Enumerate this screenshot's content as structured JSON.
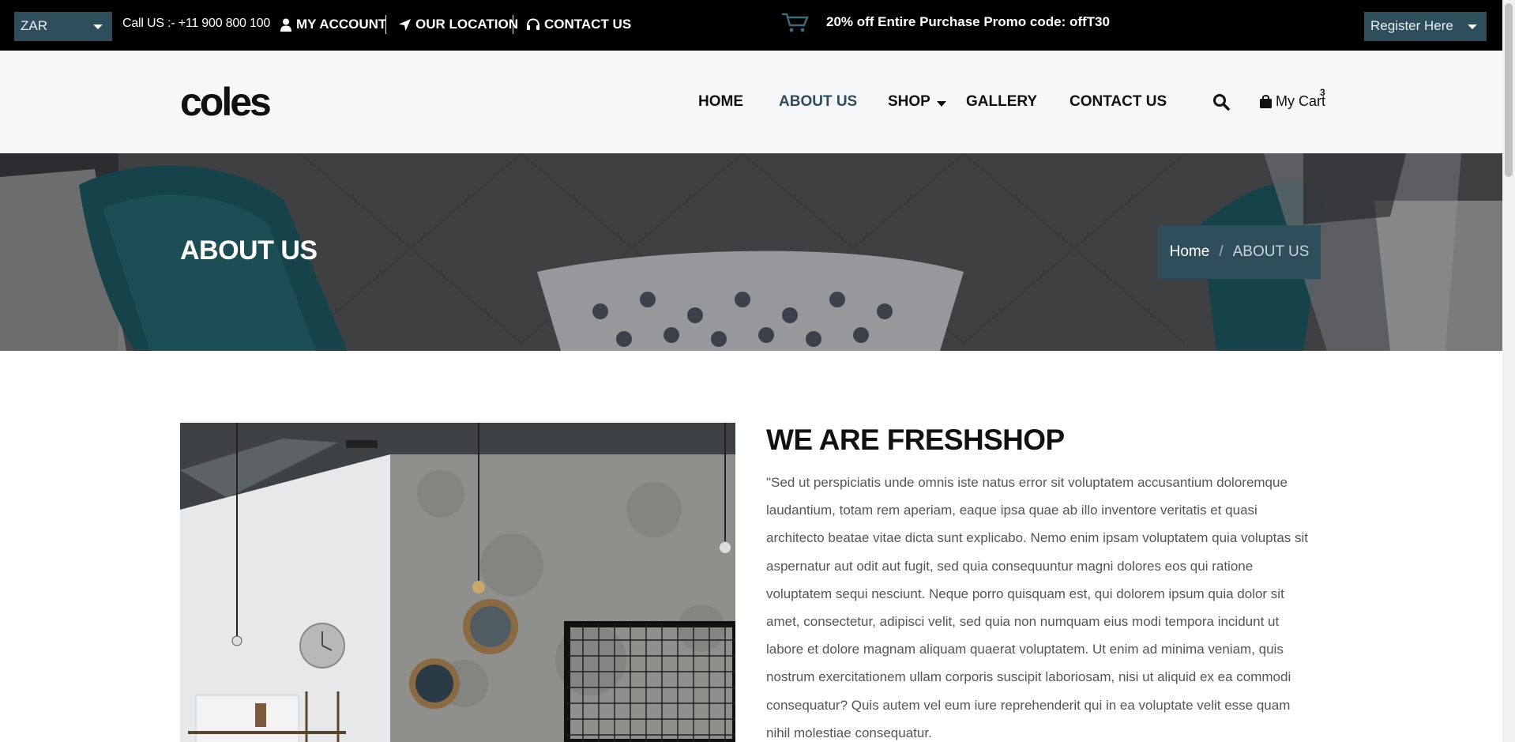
{
  "topbar": {
    "currency": "ZAR",
    "call": "Call US :- +11 900 800 100",
    "my_account": "MY ACCOUNT",
    "our_location": "OUR LOCATION",
    "contact_us": "CONTACT US",
    "promo": "20% off Entire Purchase Promo code: offT30",
    "register": "Register Here"
  },
  "header": {
    "logo": "coles",
    "nav": [
      "HOME",
      "ABOUT US",
      "SHOP",
      "GALLERY",
      "CONTACT US"
    ],
    "active_nav": "ABOUT US",
    "cart_label": "My Cart",
    "cart_count": "3"
  },
  "banner": {
    "title": "ABOUT US",
    "breadcrumb_home": "Home",
    "breadcrumb_sep": "/",
    "breadcrumb_current": "ABOUT US"
  },
  "about": {
    "heading": "WE ARE FRESHSHOP",
    "paragraph": "\"Sed ut perspiciatis unde omnis iste natus error sit voluptatem accusantium doloremque laudantium, totam rem aperiam, eaque ipsa quae ab illo inventore veritatis et quasi architecto beatae vitae dicta sunt explicabo. Nemo enim ipsam voluptatem quia voluptas sit aspernatur aut odit aut fugit, sed quia consequuntur magni dolores eos qui ratione voluptatem sequi nesciunt. Neque porro quisquam est, qui dolorem ipsum quia dolor sit amet, consectetur, adipisci velit, sed quia non numquam eius modi tempora incidunt ut labore et dolore magnam aliquam quaerat voluptatem. Ut enim ad minima veniam, quis nostrum exercitationem ullam corporis suscipit laboriosam, nisi ut aliquid ex ea commodi consequatur? Quis autem vel eum iure reprehenderit qui in ea voluptate velit esse quam nihil molestiae consequatur."
  },
  "colors": {
    "accent": "#2e4e5c",
    "topbar_bg": "#000000",
    "header_bg": "#f5f7f9"
  },
  "icons": [
    "chevron-down-icon",
    "user-icon",
    "location-arrow-icon",
    "headset-icon",
    "cart-icon",
    "search-icon",
    "bag-icon"
  ]
}
